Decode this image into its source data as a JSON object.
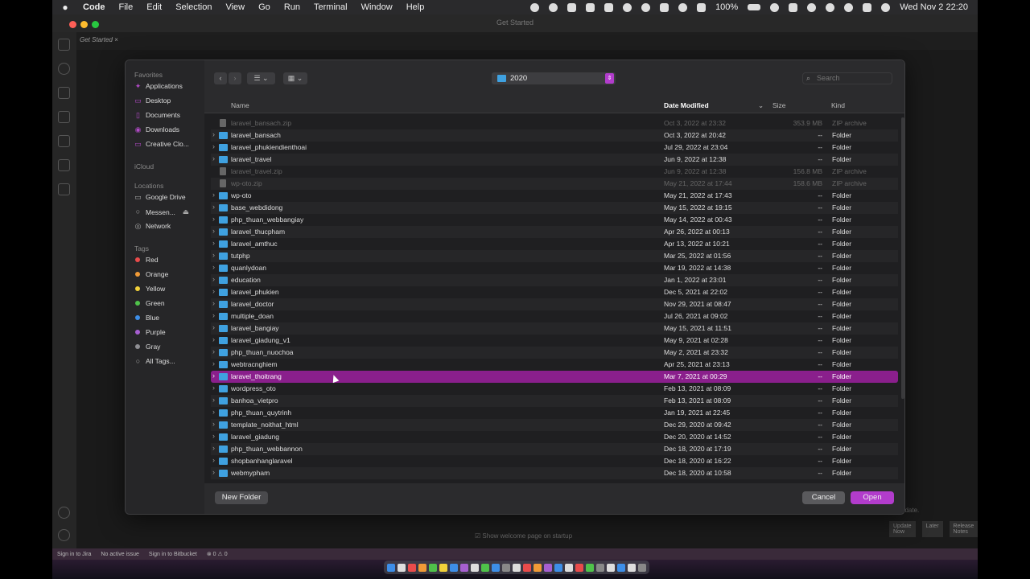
{
  "menubar": {
    "apple": "",
    "items": [
      "Code",
      "File",
      "Edit",
      "Selection",
      "View",
      "Go",
      "Run",
      "Terminal",
      "Window",
      "Help"
    ],
    "battery": "100%",
    "clock": "Wed Nov 2  22:20"
  },
  "window": {
    "title": "Get Started",
    "tab": "Get Started"
  },
  "editor": {
    "welcome_checkbox": "Show welcome page on startup",
    "notification_tail": "pdate.",
    "update_now": "Update Now",
    "later": "Later",
    "release_notes": "Release Notes"
  },
  "statusbar": {
    "jira": "Sign in to Jira",
    "issue": "No active issue",
    "bitbucket": "Sign in to Bitbucket",
    "problems": "⊗ 0 ⚠ 0"
  },
  "dialog": {
    "sidebar": {
      "favorites_header": "Favorites",
      "favorites": [
        "Applications",
        "Desktop",
        "Documents",
        "Downloads",
        "Creative Clo..."
      ],
      "icloud_header": "iCloud",
      "locations_header": "Locations",
      "locations": [
        "Google Drive",
        "Messen...",
        "Network"
      ],
      "tags_header": "Tags",
      "tags": [
        {
          "label": "Red",
          "color": "#e94b4b"
        },
        {
          "label": "Orange",
          "color": "#f09a37"
        },
        {
          "label": "Yellow",
          "color": "#f2d13a"
        },
        {
          "label": "Green",
          "color": "#4fc24a"
        },
        {
          "label": "Blue",
          "color": "#3d8ee8"
        },
        {
          "label": "Purple",
          "color": "#a65fd1"
        },
        {
          "label": "Gray",
          "color": "#8e8e93"
        }
      ],
      "all_tags": "All Tags..."
    },
    "toolbar": {
      "back": "‹",
      "forward": "›",
      "current_folder": "2020",
      "search_placeholder": "Search"
    },
    "columns": {
      "name": "Name",
      "date": "Date Modified",
      "size": "Size",
      "kind": "Kind"
    },
    "rows": [
      {
        "name": "laravel_bansach.zip",
        "date": "Oct 3, 2022 at 23:32",
        "size": "353.9 MB",
        "kind": "ZIP archive",
        "type": "zip"
      },
      {
        "name": "laravel_bansach",
        "date": "Oct 3, 2022 at 20:42",
        "size": "--",
        "kind": "Folder",
        "type": "folder"
      },
      {
        "name": "laravel_phukiendienthoai",
        "date": "Jul 29, 2022 at 23:04",
        "size": "--",
        "kind": "Folder",
        "type": "folder"
      },
      {
        "name": "laravel_travel",
        "date": "Jun 9, 2022 at 12:38",
        "size": "--",
        "kind": "Folder",
        "type": "folder"
      },
      {
        "name": "laravel_travel.zip",
        "date": "Jun 9, 2022 at 12:38",
        "size": "156.8 MB",
        "kind": "ZIP archive",
        "type": "zip"
      },
      {
        "name": "wp-oto.zip",
        "date": "May 21, 2022 at 17:44",
        "size": "158.6 MB",
        "kind": "ZIP archive",
        "type": "zip"
      },
      {
        "name": "wp-oto",
        "date": "May 21, 2022 at 17:43",
        "size": "--",
        "kind": "Folder",
        "type": "folder"
      },
      {
        "name": "base_webdidong",
        "date": "May 15, 2022 at 19:15",
        "size": "--",
        "kind": "Folder",
        "type": "folder"
      },
      {
        "name": "php_thuan_webbangiay",
        "date": "May 14, 2022 at 00:43",
        "size": "--",
        "kind": "Folder",
        "type": "folder"
      },
      {
        "name": "laravel_thucpham",
        "date": "Apr 26, 2022 at 00:13",
        "size": "--",
        "kind": "Folder",
        "type": "folder"
      },
      {
        "name": "laravel_amthuc",
        "date": "Apr 13, 2022 at 10:21",
        "size": "--",
        "kind": "Folder",
        "type": "folder"
      },
      {
        "name": "tutphp",
        "date": "Mar 25, 2022 at 01:56",
        "size": "--",
        "kind": "Folder",
        "type": "folder"
      },
      {
        "name": "quanlydoan",
        "date": "Mar 19, 2022 at 14:38",
        "size": "--",
        "kind": "Folder",
        "type": "folder"
      },
      {
        "name": "education",
        "date": "Jan 1, 2022 at 23:01",
        "size": "--",
        "kind": "Folder",
        "type": "folder"
      },
      {
        "name": "laravel_phukien",
        "date": "Dec 5, 2021 at 22:02",
        "size": "--",
        "kind": "Folder",
        "type": "folder"
      },
      {
        "name": "laravel_doctor",
        "date": "Nov 29, 2021 at 08:47",
        "size": "--",
        "kind": "Folder",
        "type": "folder"
      },
      {
        "name": "multiple_doan",
        "date": "Jul 26, 2021 at 09:02",
        "size": "--",
        "kind": "Folder",
        "type": "folder"
      },
      {
        "name": "laravel_bangiay",
        "date": "May 15, 2021 at 11:51",
        "size": "--",
        "kind": "Folder",
        "type": "folder"
      },
      {
        "name": "laravel_giadung_v1",
        "date": "May 9, 2021 at 02:28",
        "size": "--",
        "kind": "Folder",
        "type": "folder"
      },
      {
        "name": "php_thuan_nuochoa",
        "date": "May 2, 2021 at 23:32",
        "size": "--",
        "kind": "Folder",
        "type": "folder"
      },
      {
        "name": "webtracnghiem",
        "date": "Apr 25, 2021 at 23:13",
        "size": "--",
        "kind": "Folder",
        "type": "folder"
      },
      {
        "name": "laravel_thoitrang",
        "date": "Mar 7, 2021 at 00:29",
        "size": "--",
        "kind": "Folder",
        "type": "folder",
        "selected": true
      },
      {
        "name": "wordpress_oto",
        "date": "Feb 13, 2021 at 08:09",
        "size": "--",
        "kind": "Folder",
        "type": "folder"
      },
      {
        "name": "banhoa_vietpro",
        "date": "Feb 13, 2021 at 08:09",
        "size": "--",
        "kind": "Folder",
        "type": "folder"
      },
      {
        "name": "php_thuan_quytrinh",
        "date": "Jan 19, 2021 at 22:45",
        "size": "--",
        "kind": "Folder",
        "type": "folder"
      },
      {
        "name": "template_noithat_html",
        "date": "Dec 29, 2020 at 09:42",
        "size": "--",
        "kind": "Folder",
        "type": "folder"
      },
      {
        "name": "laravel_giadung",
        "date": "Dec 20, 2020 at 14:52",
        "size": "--",
        "kind": "Folder",
        "type": "folder"
      },
      {
        "name": "php_thuan_webbannon",
        "date": "Dec 18, 2020 at 17:19",
        "size": "--",
        "kind": "Folder",
        "type": "folder"
      },
      {
        "name": "shopbanhanglaravel",
        "date": "Dec 18, 2020 at 16:22",
        "size": "--",
        "kind": "Folder",
        "type": "folder"
      },
      {
        "name": "webmypham",
        "date": "Dec 18, 2020 at 10:58",
        "size": "--",
        "kind": "Folder",
        "type": "folder"
      }
    ],
    "footer": {
      "new_folder": "New Folder",
      "cancel": "Cancel",
      "open": "Open"
    }
  },
  "colors": {
    "accent": "#b23ccc",
    "selection": "#8a1f8c",
    "folder": "#3fa1e0"
  }
}
